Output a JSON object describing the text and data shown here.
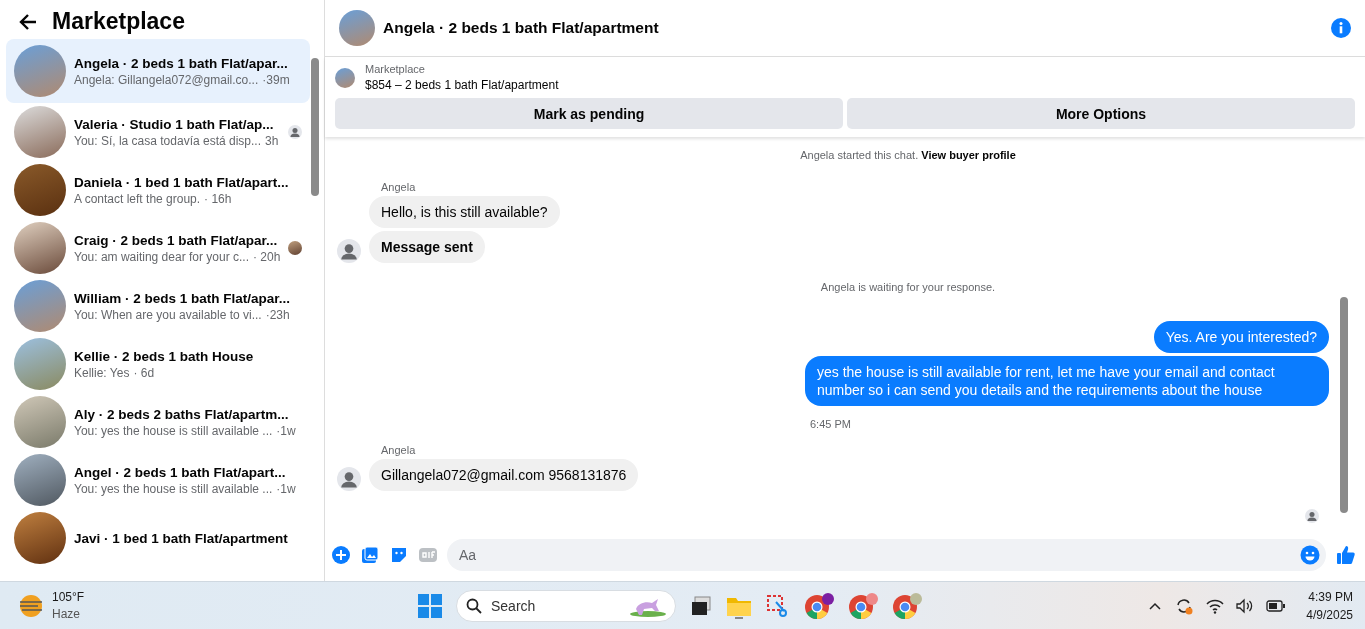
{
  "sidebar": {
    "title": "Marketplace",
    "conversations": [
      {
        "title": "Angela · 2 beds 1 bath Flat/apar...",
        "preview": "Angela: Gillangela072@gmail.co...",
        "time": "·39m",
        "selected": true
      },
      {
        "title": "Valeria · Studio 1 bath Flat/ap...",
        "preview": "You: Sí, la casa todavía está disp...",
        "time": "3h",
        "selected": false,
        "seen_by": {
          "kind": "silhouette"
        }
      },
      {
        "title": "Daniela · 1 bed 1 bath Flat/apart...",
        "preview": "A contact left the group.",
        "time": "· 16h",
        "selected": false
      },
      {
        "title": "Craig · 2 beds 1 bath Flat/apar...",
        "preview": "You: am waiting dear for your c...",
        "time": "· 20h",
        "selected": false,
        "seen_by": {
          "kind": "photo"
        }
      },
      {
        "title": "William · 2 beds 1 bath Flat/apar...",
        "preview": "You: When are you available to vi...",
        "time": "·23h",
        "selected": false
      },
      {
        "title": "Kellie · 2 beds 1 bath House",
        "preview": "Kellie: Yes",
        "time": "· 6d",
        "selected": false
      },
      {
        "title": "Aly · 2 beds 2 baths Flat/apartm...",
        "preview": "You: yes the house is still available ...",
        "time": "·1w",
        "selected": false
      },
      {
        "title": "Angel · 2 beds 1 bath Flat/apart...",
        "preview": "You: yes the house is still available ...",
        "time": "·1w",
        "selected": false
      },
      {
        "title": "Javi · 1 bed 1 bath Flat/apartment",
        "selected": false
      }
    ]
  },
  "chat": {
    "title": "Angela · 2 beds 1 bath Flat/apartment",
    "listing": {
      "label": "Marketplace",
      "title": "$854 – 2 beds 1 bath Flat/apartment"
    },
    "buttons": [
      "Mark as pending",
      "More Options"
    ],
    "messages": [
      {
        "kind": "system",
        "text": "Angela started this chat.",
        "link": "View buyer profile"
      },
      {
        "kind": "incoming",
        "sender": "Angela",
        "bubbles": [
          {
            "text": "Hello, is this still available?",
            "bold": false
          },
          {
            "text": "Message sent",
            "bold": true
          }
        ]
      },
      {
        "kind": "system",
        "text": "Angela is waiting for your response."
      },
      {
        "kind": "outgoing",
        "bubbles": [
          {
            "text": "Yes. Are you interested?",
            "bold": false
          },
          {
            "text": "yes the house is still available for rent, let me have your email  and contact number so i can send you details and the requirements about the house",
            "bold": false
          }
        ]
      },
      {
        "kind": "time",
        "text": "6:45 PM"
      },
      {
        "kind": "incoming",
        "sender": "Angela",
        "bubbles": [
          {
            "text": "Gillangela072@gmail.com 9568131876",
            "bold": false
          }
        ]
      }
    ],
    "composer": {
      "placeholder": "Aa"
    }
  },
  "taskbar": {
    "weather": {
      "temperature": "105°F",
      "condition": "Haze"
    },
    "search": {
      "placeholder": "Search"
    },
    "clock": {
      "time": "4:39 PM",
      "date": "4/9/2025"
    }
  }
}
